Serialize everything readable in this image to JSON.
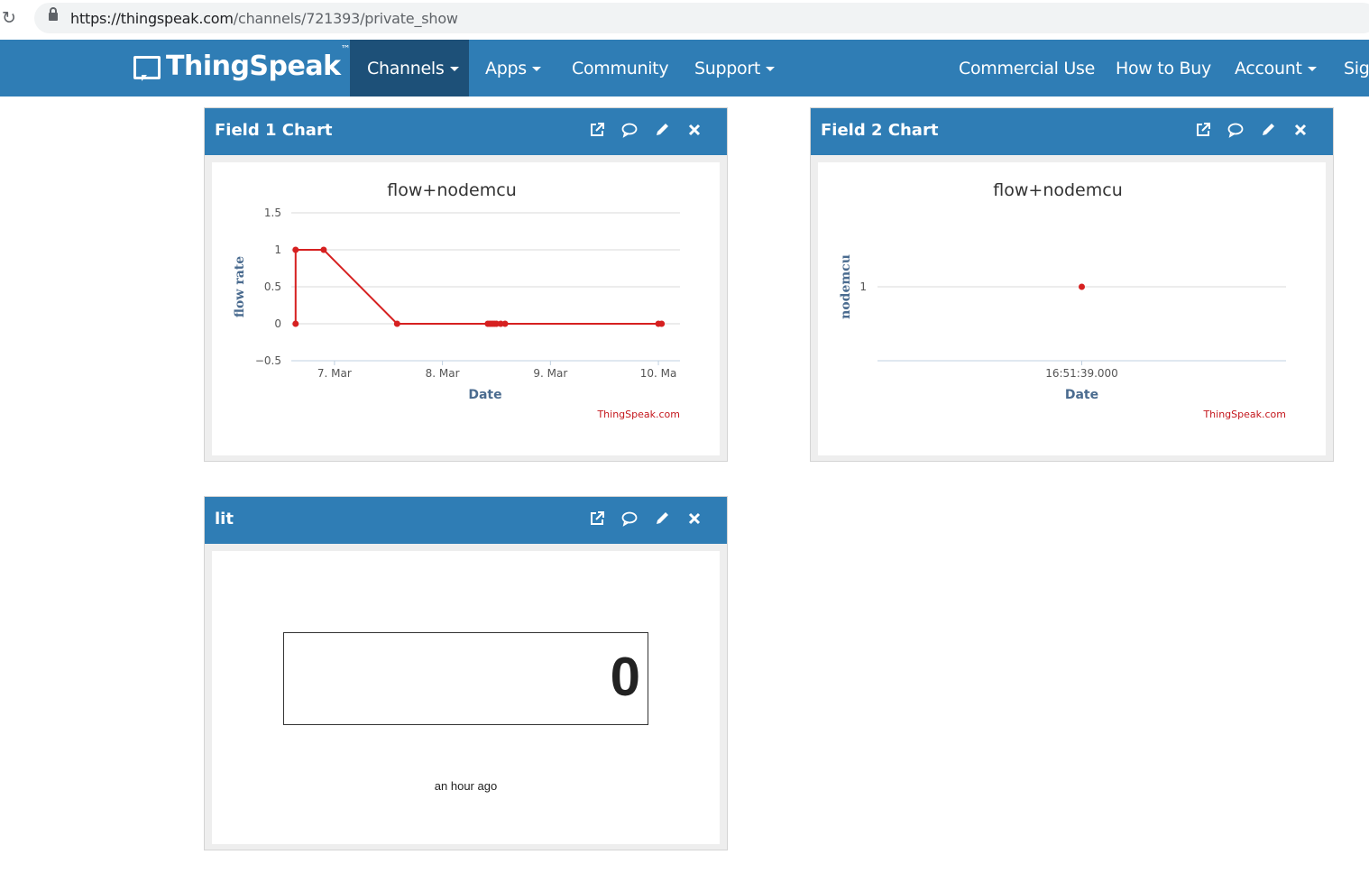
{
  "browser": {
    "url_host": "https://thingspeak.com",
    "url_path": "/channels/721393/private_show"
  },
  "navbar": {
    "logo": "ThingSpeak",
    "logo_tm": "™",
    "items": [
      {
        "label": "Channels",
        "dropdown": true,
        "active": true
      },
      {
        "label": "Apps",
        "dropdown": true
      },
      {
        "label": "Community",
        "dropdown": false
      },
      {
        "label": "Support",
        "dropdown": true
      },
      {
        "label": "Commercial Use",
        "dropdown": false
      },
      {
        "label": "How to Buy",
        "dropdown": false
      },
      {
        "label": "Account",
        "dropdown": true
      },
      {
        "label": "Sig",
        "dropdown": false
      }
    ]
  },
  "widgets": [
    {
      "title": "Field 1 Chart"
    },
    {
      "title": "Field 2 Chart"
    },
    {
      "title": "lit"
    }
  ],
  "icons": [
    "external-link-icon",
    "comment-icon",
    "pencil-icon",
    "close-icon"
  ],
  "colors": {
    "brand": "#2f7db5",
    "active_nav": "#1d5078",
    "series": "#d62020",
    "credit": "#c4161c"
  },
  "chart_data": [
    {
      "type": "line",
      "title": "flow+nodemcu",
      "xlabel": "Date",
      "ylabel": "flow rate",
      "credit": "ThingSpeak.com",
      "xlim": [
        6.6,
        10.2
      ],
      "ylim": [
        -0.5,
        1.5
      ],
      "yticks": [
        1.5,
        1,
        0.5,
        0,
        -0.5
      ],
      "ytick_labels": [
        "1.5",
        "1",
        "0.5",
        "0",
        "−0.5"
      ],
      "xticks": [
        7,
        8,
        9,
        10
      ],
      "xtick_labels": [
        "7. Mar",
        "8. Mar",
        "9. Mar",
        "10. Ma"
      ],
      "grid": true,
      "series": [
        {
          "x": [
            6.64,
            6.64,
            6.9,
            7.58,
            8.42,
            8.44,
            8.46,
            8.48,
            8.5,
            8.54,
            8.58,
            10.0,
            10.03
          ],
          "y": [
            0,
            1,
            1,
            0,
            0,
            0,
            0,
            0,
            0,
            0,
            0,
            0,
            0
          ]
        }
      ]
    },
    {
      "type": "scatter",
      "title": "flow+nodemcu",
      "xlabel": "Date",
      "ylabel": "nodemcu",
      "credit": "ThingSpeak.com",
      "yticks": [
        1
      ],
      "ytick_labels": [
        "1"
      ],
      "xtick_labels": [
        "16:51:39.000"
      ],
      "grid": true,
      "series": [
        {
          "x": [
            "16:51:39.000"
          ],
          "y": [
            1
          ]
        }
      ]
    }
  ],
  "lamp": {
    "value": "0",
    "time": "an hour ago"
  }
}
